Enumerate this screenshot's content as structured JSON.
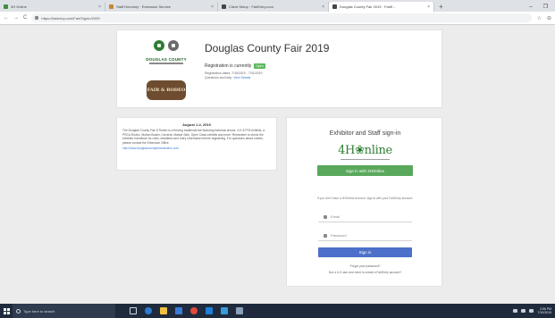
{
  "browser": {
    "tabs": [
      {
        "label": "4H Online",
        "active": false
      },
      {
        "label": "Staff Directory · Extension Service",
        "active": false
      },
      {
        "label": "Client Setup · FairEntry.com",
        "active": false
      },
      {
        "label": "Douglas County Fair 2019 · FairE...",
        "active": true
      }
    ],
    "new_tab": "+",
    "url": "https://fairentry.com/Fair/SignIn/2009",
    "nav": {
      "back": "←",
      "forward": "→",
      "reload": "C"
    },
    "window": {
      "minimize": "–",
      "maximize": "❐"
    }
  },
  "header": {
    "org_name": "DOUGLAS COUNTY",
    "badge_text": "FAIR & RODEO",
    "title": "Douglas County Fair 2019",
    "registration_text": "Registration is currently",
    "status": "Open",
    "registration_dates": "Registration dates: 7/15/2019 - 7/31/2019",
    "questions_text": "Questions and help:",
    "details_link": "View Details"
  },
  "info": {
    "heading": "August 1-4, 2019",
    "body": "The Douglas County Fair & Rodeo is a thriving traditional fair featuring livestock shows, 4-H & FFA exhibits, a PRCA Rodeo, Mutton Bustin, Carnival, Market Sale, Open Class exhibits and more. Remember to check the exhibitor handbook for rules, deadlines and entry information before registering. For questions about entries, please contact the Extension Office.",
    "link": "http://www.douglascountyfairandrodeo.com"
  },
  "signin": {
    "title": "Exhibitor and Staff sign-in",
    "brand": "4H❀nline",
    "btn_4h": "Sign in with 4HOnline",
    "hint": "If you don't have a 4HOnline account, sign in with your FairEntry account:",
    "email_placeholder": "Email",
    "password_placeholder": "Password",
    "btn_signin": "Sign in",
    "forgot": "Forgot your password?",
    "create": "Not a 4-H user and need to create a FairEntry account?"
  },
  "taskbar": {
    "search_placeholder": "Type here to search",
    "time": "2:56 PM",
    "date": "7/10/2019"
  },
  "colors": {
    "green": "#5aa85c",
    "blue": "#4c6fc9",
    "brand": "#2e7d32"
  }
}
